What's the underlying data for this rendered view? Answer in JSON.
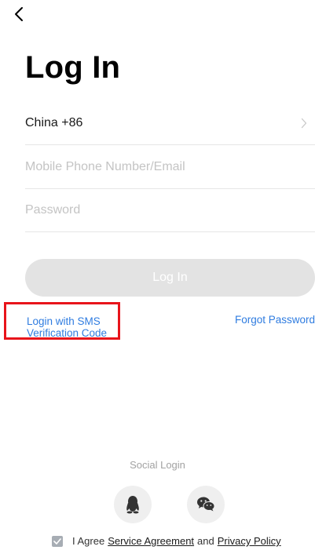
{
  "header": {
    "back_icon": "chevron-left-icon",
    "title": "Log In"
  },
  "form": {
    "country_code": "China +86",
    "phone_placeholder": "Mobile Phone Number/Email",
    "password_placeholder": "Password",
    "login_button": "Log In"
  },
  "links": {
    "sms_login_line1": "Login with SMS",
    "sms_login_line2": "Verification Code",
    "forgot_password": "Forgot Password"
  },
  "social": {
    "title": "Social Login",
    "providers": [
      {
        "name": "QQ",
        "icon": "qq-icon"
      },
      {
        "name": "WeChat",
        "icon": "wechat-icon"
      }
    ]
  },
  "agreement": {
    "prefix": "I Agree",
    "service_agreement": "Service Agreement",
    "and": "and",
    "privacy_policy": "Privacy Policy"
  },
  "colors": {
    "link": "#2f7ce0",
    "highlight_box": "#e8141b",
    "button_disabled": "#e3e3e3"
  }
}
